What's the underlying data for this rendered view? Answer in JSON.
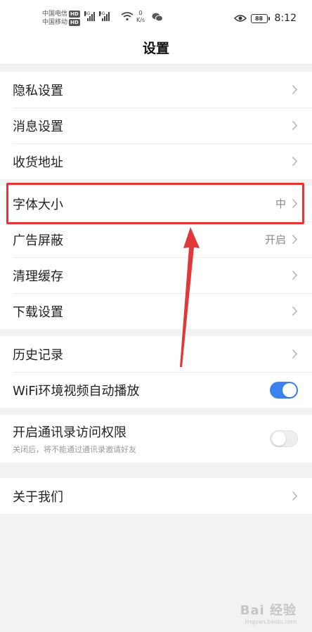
{
  "status_bar": {
    "carrier1": "中国电信",
    "carrier2": "中国移动",
    "hd_badge": "HD",
    "net_label": "4G",
    "speed_value": "0",
    "speed_unit": "K/s",
    "battery": "88",
    "time": "8:12"
  },
  "header": {
    "title": "设置"
  },
  "groups": [
    {
      "items": [
        {
          "label": "隐私设置"
        },
        {
          "label": "消息设置"
        },
        {
          "label": "收货地址"
        }
      ]
    },
    {
      "items": [
        {
          "label": "字体大小",
          "value": "中"
        },
        {
          "label": "广告屏蔽",
          "value": "开启"
        },
        {
          "label": "清理缓存"
        },
        {
          "label": "下载设置"
        }
      ]
    },
    {
      "items": [
        {
          "label": "历史记录"
        },
        {
          "label": "WiFi环境视频自动播放",
          "toggle": true
        }
      ]
    },
    {
      "items": [
        {
          "label": "开启通讯录访问权限",
          "sublabel": "关闭后，将不能通过通讯录邀请好友",
          "toggle": false
        }
      ]
    },
    {
      "items": [
        {
          "label": "关于我们"
        }
      ]
    }
  ],
  "annotation": {
    "highlight_color": "#e0373a"
  },
  "colors": {
    "toggle_on": "#3b82f0",
    "background": "#f2f2f2"
  },
  "watermark": {
    "main": "Bai 经验",
    "sub": "jingyan.baidu.com"
  }
}
